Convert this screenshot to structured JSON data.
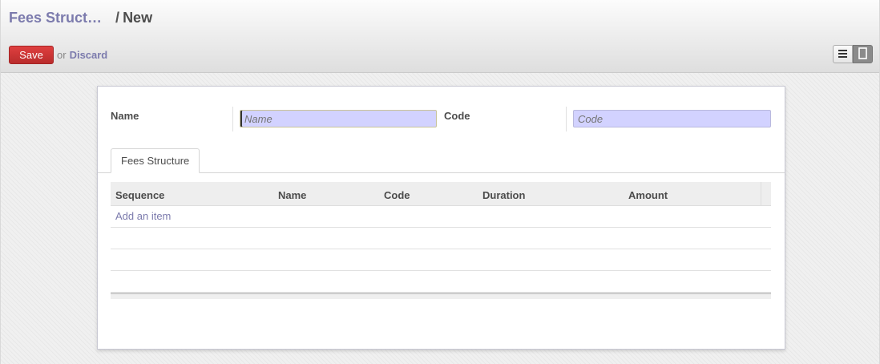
{
  "breadcrumb": {
    "parent": "Fees Struct…",
    "separator": "/",
    "current": "New"
  },
  "toolbar": {
    "save_label": "Save",
    "or_text": "or",
    "discard_label": "Discard"
  },
  "view_switcher": {
    "list_icon": "list-icon",
    "form_icon": "form-view-icon",
    "active": "form"
  },
  "form": {
    "name_label": "Name",
    "name_placeholder": "Name",
    "name_value": "",
    "code_label": "Code",
    "code_placeholder": "Code",
    "code_value": ""
  },
  "tabs": [
    {
      "label": "Fees Structure",
      "active": true
    }
  ],
  "table": {
    "columns": [
      "Sequence",
      "Name",
      "Code",
      "Duration",
      "Amount"
    ],
    "add_item_label": "Add an item",
    "rows": []
  },
  "colors": {
    "accent": "#7c7bad",
    "save_button": "#d03434",
    "input_background": "#d2d2ff"
  }
}
